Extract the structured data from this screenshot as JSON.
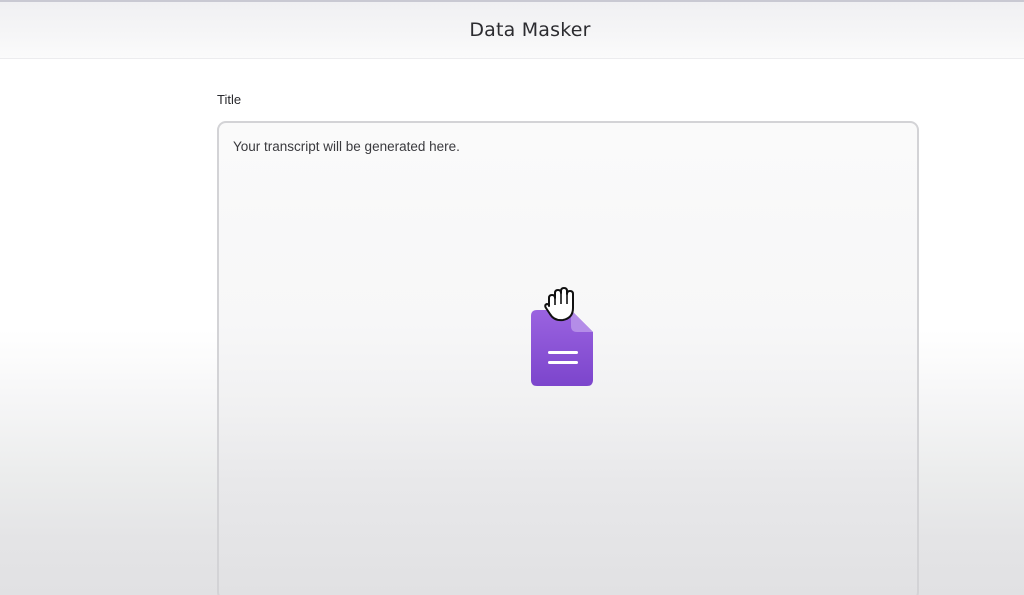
{
  "header": {
    "title": "Data Masker"
  },
  "form": {
    "title_label": "Title",
    "transcript_placeholder": "Your transcript will be generated here."
  },
  "icons": {
    "file": "document-icon",
    "cursor": "grab-hand-cursor-icon"
  },
  "colors": {
    "accent_purple": "#8c55d6",
    "accent_purple_dark": "#7a43c9"
  }
}
